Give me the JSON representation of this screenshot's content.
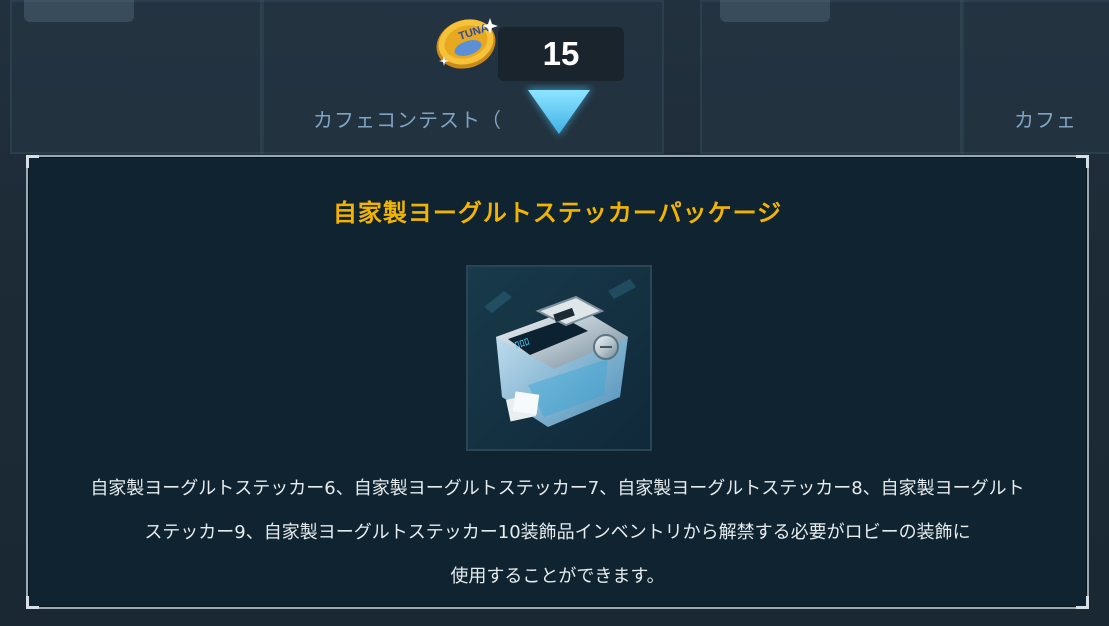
{
  "currency": {
    "icon": "tuna-coin-icon",
    "coin_text": "TUNA",
    "amount": "15"
  },
  "background": {
    "left_label": "カフェコンテスト（",
    "right_label": "カフェ"
  },
  "panel": {
    "title": "自家製ヨーグルトステッカーパッケージ",
    "item_icon": "sticker-package-icon",
    "description_lines": [
      "自家製ヨーグルトステッカー6、自家製ヨーグルトステッカー7、自家製ヨーグルトステッカー8、自家製ヨーグルト",
      "ステッカー9、自家製ヨーグルトステッカー10装飾品インベントリから解禁する必要がロビーの装飾に",
      "使用することができます。"
    ]
  },
  "colors": {
    "title": "#f2b400",
    "panel_bg": "#0f2330",
    "panel_border": "#9aa9b3",
    "arrow": "#5cc8f0",
    "label": "#7fa4c4"
  }
}
